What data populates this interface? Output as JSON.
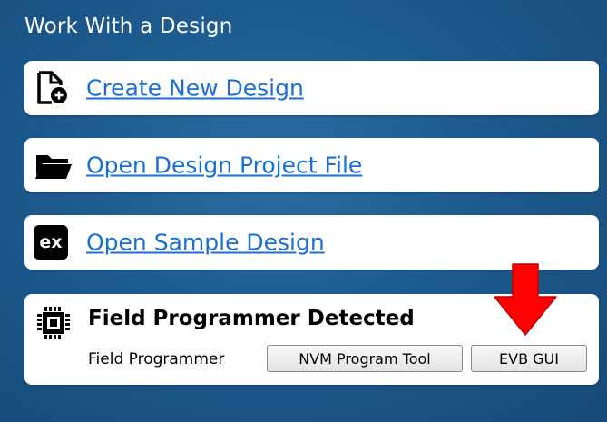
{
  "panel": {
    "title": "Work With a Design"
  },
  "actions": [
    {
      "label": "Create New Design",
      "icon": "new-file-icon"
    },
    {
      "label": "Open Design Project File",
      "icon": "folder-icon"
    },
    {
      "label": "Open Sample Design",
      "icon": "example-badge-icon",
      "badge": "ex"
    }
  ],
  "field_programmer": {
    "title": "Field Programmer Detected",
    "icon": "chip-icon",
    "label": "Field Programmer",
    "nvm_button": "NVM Program Tool",
    "evb_button": "EVB GUI"
  },
  "annotation": {
    "icon": "red-down-arrow-icon",
    "color": "#ff0000"
  },
  "colors": {
    "link": "#1a6fd6",
    "background": "#1d5a8e"
  }
}
